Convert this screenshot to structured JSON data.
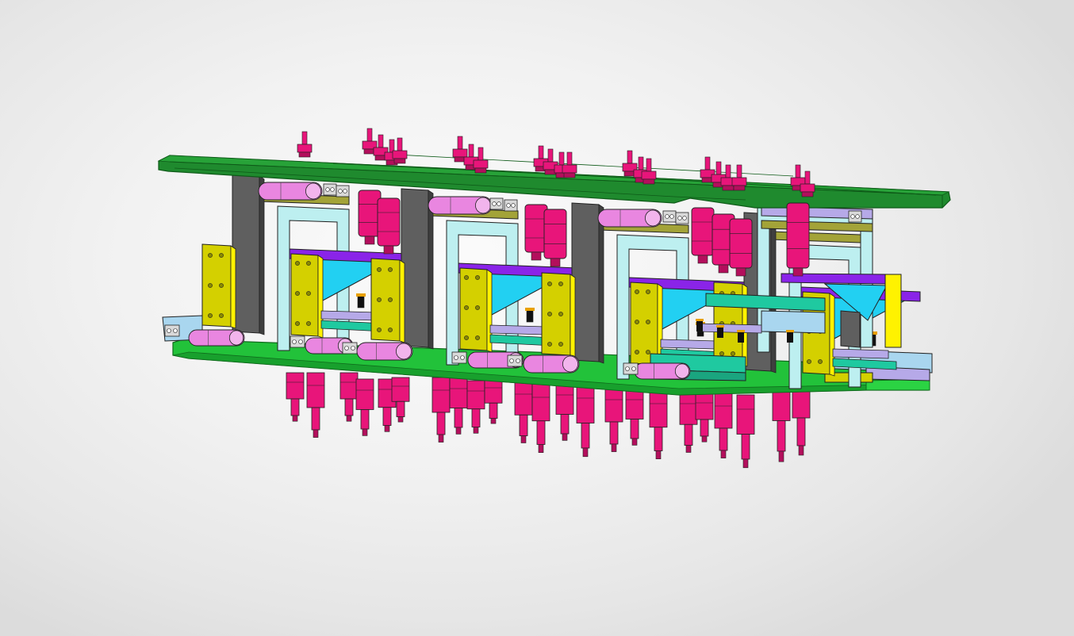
{
  "viewer": {
    "background": [
      "#ffffff",
      "#dcdcdc"
    ],
    "model": {
      "kind": "cad-assembly",
      "colors": {
        "plate_top": "#1f8a2e",
        "plate_top_edge": "#137020",
        "plate_bottom": "#22c23a",
        "cylinder": "#e8157a",
        "cylinder_dark": "#b30f5c",
        "roller": "#e986e0",
        "side_plate": "#d4d000",
        "side_plate_bright": "#fff200",
        "dark_bracket": "#5f5f5f",
        "frame": "#bdeff0",
        "wedge": "#22d0f2",
        "purple_bar": "#8a24e8",
        "olive_bar": "#a3a338",
        "lilac": "#b6a9e8",
        "teal": "#1fc9a0",
        "pale_blue": "#a9d6ef"
      }
    }
  }
}
